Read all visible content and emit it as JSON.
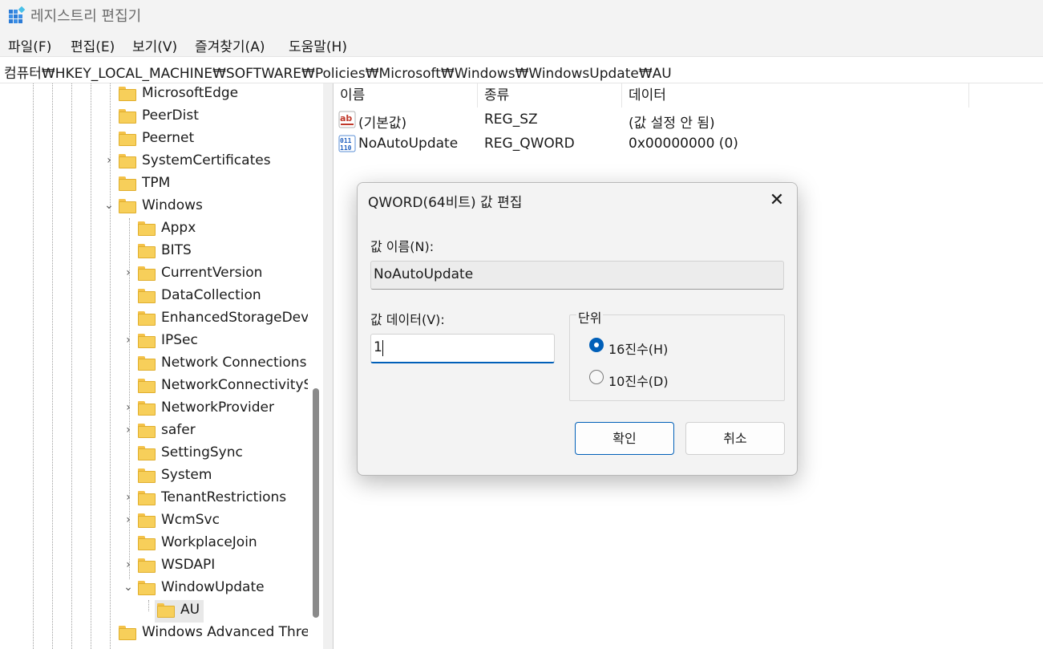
{
  "window": {
    "title": "레지스트리 편집기"
  },
  "menu": [
    "파일(F)",
    "편집(E)",
    "보기(V)",
    "즐겨찾기(A)",
    "도움말(H)"
  ],
  "address": "컴퓨터₩HKEY_LOCAL_MACHINE₩SOFTWARE₩Policies₩Microsoft₩Windows₩WindowsUpdate₩AU",
  "tree": [
    {
      "label": "MicrosoftEdge",
      "expander": ""
    },
    {
      "label": "PeerDist",
      "expander": ""
    },
    {
      "label": "Peernet",
      "expander": ""
    },
    {
      "label": "SystemCertificates",
      "expander": "›"
    },
    {
      "label": "TPM",
      "expander": ""
    },
    {
      "label": "Windows",
      "expander": "⌄"
    },
    {
      "label": "Appx",
      "expander": ""
    },
    {
      "label": "BITS",
      "expander": ""
    },
    {
      "label": "CurrentVersion",
      "expander": "›"
    },
    {
      "label": "DataCollection",
      "expander": ""
    },
    {
      "label": "EnhancedStorageDevic",
      "expander": ""
    },
    {
      "label": "IPSec",
      "expander": "›"
    },
    {
      "label": "Network Connections",
      "expander": ""
    },
    {
      "label": "NetworkConnectivitySt",
      "expander": ""
    },
    {
      "label": "NetworkProvider",
      "expander": "›"
    },
    {
      "label": "safer",
      "expander": "›"
    },
    {
      "label": "SettingSync",
      "expander": ""
    },
    {
      "label": "System",
      "expander": ""
    },
    {
      "label": "TenantRestrictions",
      "expander": "›"
    },
    {
      "label": "WcmSvc",
      "expander": "›"
    },
    {
      "label": "WorkplaceJoin",
      "expander": ""
    },
    {
      "label": "WSDAPI",
      "expander": "›"
    },
    {
      "label": "WindowUpdate",
      "expander": "⌄"
    },
    {
      "label": "AU",
      "expander": ""
    },
    {
      "label": "Windows Advanced Thre",
      "expander": ""
    }
  ],
  "list": {
    "columns": [
      "이름",
      "종류",
      "데이터"
    ],
    "rows": [
      {
        "icon": "string-value-icon",
        "name": "(기본값)",
        "type": "REG_SZ",
        "data": "(값 설정 안 됨)"
      },
      {
        "icon": "binary-value-icon",
        "name": "NoAutoUpdate",
        "type": "REG_QWORD",
        "data": "0x00000000 (0)"
      }
    ]
  },
  "dialog": {
    "title": "QWORD(64비트) 값 편집",
    "close": "✕",
    "name_label": "값 이름(N):",
    "name_value": "NoAutoUpdate",
    "data_label": "값 데이터(V):",
    "data_value": "1",
    "base_group": "단위",
    "hex_label": "16진수(H)",
    "dec_label": "10진수(D)",
    "selected_base": "hex",
    "ok": "확인",
    "cancel": "취소"
  },
  "colors": {
    "accent": "#005fb8",
    "folder": "#f7cf5a"
  }
}
